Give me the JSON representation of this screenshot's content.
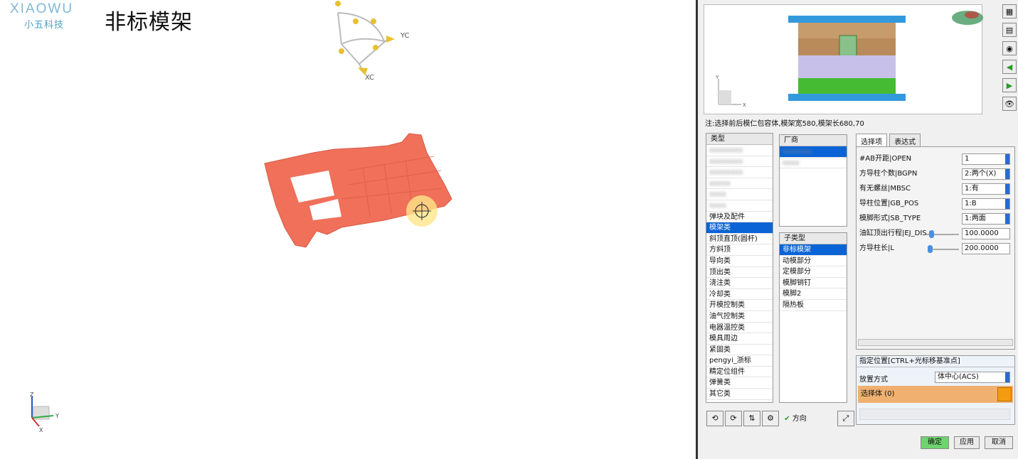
{
  "header": {
    "brand": "XIAOWU",
    "brand_sub": "小五科技",
    "title": "非标模架"
  },
  "viewport": {
    "triad_top": {
      "yc": "YC",
      "xc": "XC"
    },
    "triad_bottom": {
      "z": "Z",
      "y": "Y",
      "x": "X"
    },
    "part_color": "#f0705a"
  },
  "dialog": {
    "preview": {
      "axis_y": "Y",
      "axis_x": "X"
    },
    "note": "注:选择前后模仁包容体,模架宽580,模架长680,70",
    "type_list": {
      "header": "类型",
      "blurred_items": [
        "xxxxxxxx",
        "xxxxxxxx",
        "xxxxxxxx",
        "xxxxx",
        "xxxx",
        "xxxx"
      ],
      "items": [
        "弹块及配件",
        "模架类",
        "斜顶直顶(圆杆)",
        "方斜顶",
        "导向类",
        "顶出类",
        "浇注类",
        "冷却类",
        "开模控制类",
        "油气控制类",
        "电器温控类",
        "模具周边",
        "紧固类",
        "pengyi_浙标",
        "精定位组件",
        "弹簧类",
        "其它类"
      ],
      "selected_index": 1
    },
    "vendor_list": {
      "header": "厂商",
      "blurred_items": [
        "xxxxxxx",
        "xxxx"
      ]
    },
    "subtype_list": {
      "header": "子类型",
      "items": [
        "非标模架",
        "动模部分",
        "定模部分",
        "模脚销钉",
        "模脚2",
        "隔热板"
      ],
      "selected_index": 0
    },
    "tabs": [
      "选择项",
      "表达式"
    ],
    "params": [
      {
        "label": "#AB开距|OPEN",
        "value": "1"
      },
      {
        "label": "方导柱个数|BGPN",
        "value": "2:两个(X)"
      },
      {
        "label": "有无螺丝|MBSC",
        "value": "1:有"
      },
      {
        "label": "导柱位置|GB_POS",
        "value": "1:B"
      },
      {
        "label": "模脚形式|SB_TYPE",
        "value": "1:两面"
      },
      {
        "label": "油缸顶出行程|EJ_DIS",
        "value": "100.0000"
      },
      {
        "label": "方导柱长|L",
        "value": "200.0000"
      }
    ],
    "placement": {
      "header": "指定位置[CTRL+光标移基准点]",
      "method_label": "放置方式",
      "method_value": "体中心(ACS)",
      "select_label": "选择体 (0)"
    },
    "direction_label": "方向",
    "buttons": {
      "ok": "确定",
      "apply": "应用",
      "cancel": "取消"
    }
  }
}
